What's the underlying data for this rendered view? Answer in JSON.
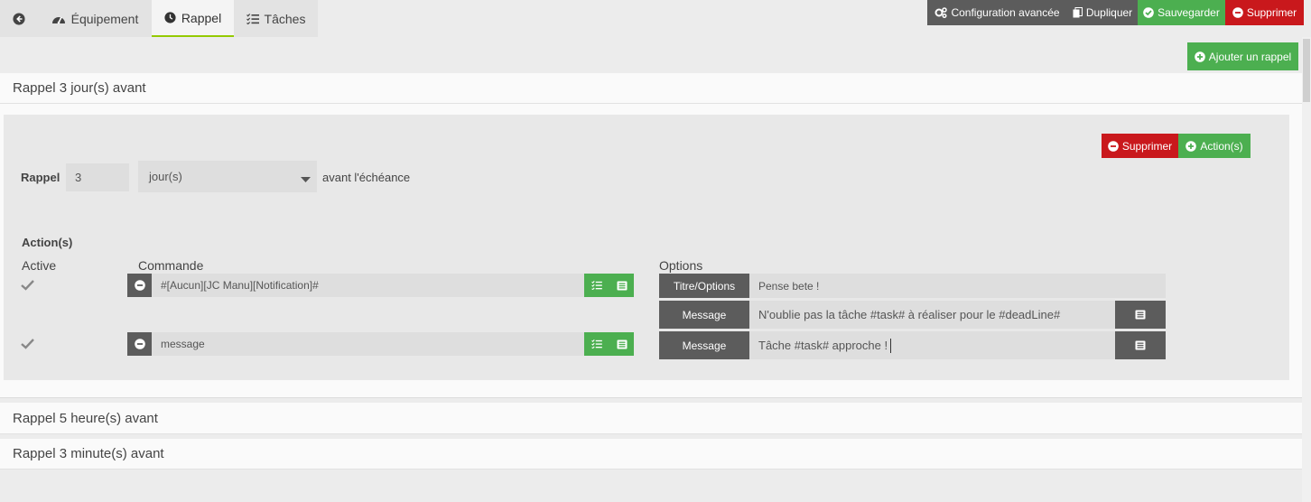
{
  "tabs": {
    "back_label": "",
    "equipment": "Équipement",
    "reminder": "Rappel",
    "tasks": "Tâches"
  },
  "toolbar": {
    "advanced_config": "Configuration avancée",
    "duplicate": "Dupliquer",
    "save": "Sauvegarder",
    "delete": "Supprimer",
    "add_reminder": "Ajouter un rappel"
  },
  "reminders": [
    {
      "title": "Rappel 3 jour(s) avant",
      "delete_label": "Supprimer",
      "action_label": "Action(s)",
      "rappel_label": "Rappel",
      "value": "3",
      "unit": "jour(s)",
      "suffix": "avant l'échéance",
      "actions_title": "Action(s)",
      "col_active": "Active",
      "col_command": "Commande",
      "col_options": "Options",
      "rows": [
        {
          "command": "#[Aucun][JC Manu][Notification]#",
          "options": [
            {
              "label": "Titre/Options",
              "value": "Pense bete !"
            },
            {
              "label": "Message",
              "value": "N'oublie pas la tâche #task# à réaliser pour le #deadLine#"
            }
          ]
        },
        {
          "command": "message",
          "options": [
            {
              "label": "Message",
              "value": "Tâche #task# approche !"
            }
          ]
        }
      ]
    },
    {
      "title": "Rappel 5 heure(s) avant"
    },
    {
      "title": "Rappel 3 minute(s) avant"
    }
  ],
  "colors": {
    "green": "#4caf50",
    "red": "#c9181c",
    "dark": "#5c5c5c",
    "tab_accent": "#94ca02"
  }
}
